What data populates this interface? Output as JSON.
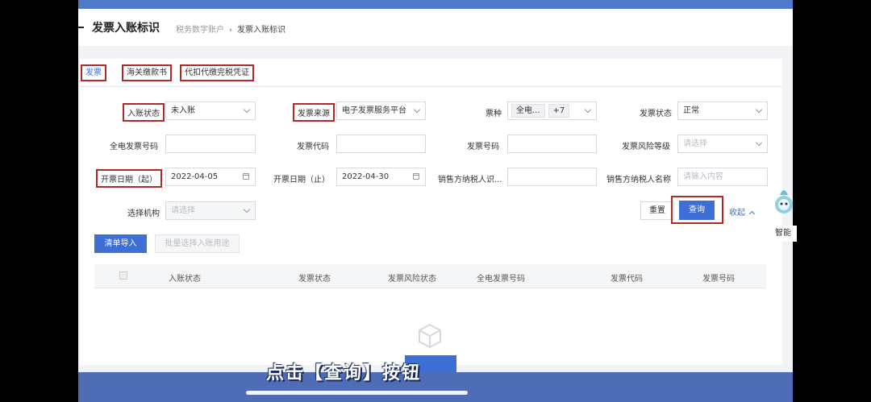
{
  "header": {
    "title": "发票入账标识",
    "breadcrumb": {
      "parent": "税务数字账户",
      "current": "发票入账标识"
    }
  },
  "tabs": [
    {
      "label": "发票"
    },
    {
      "label": "海关缴款书"
    },
    {
      "label": "代扣代缴完税凭证"
    }
  ],
  "filters": {
    "entry_status": {
      "label": "入账状态",
      "value": "未入账"
    },
    "invoice_source": {
      "label": "发票来源",
      "value": "电子发票服务平台"
    },
    "invoice_type": {
      "label": "票种",
      "tag": "全电...",
      "more": "+7"
    },
    "invoice_status": {
      "label": "发票状态",
      "value": "正常"
    },
    "full_e_number": {
      "label": "全电发票号码"
    },
    "invoice_code": {
      "label": "发票代码"
    },
    "invoice_number": {
      "label": "发票号码"
    },
    "risk_level": {
      "label": "发票风险等级",
      "placeholder": "请选择"
    },
    "date_start": {
      "label": "开票日期（起）",
      "value": "2022-04-05"
    },
    "date_end": {
      "label": "开票日期（止）",
      "value": "2022-04-30"
    },
    "seller_tax_id": {
      "label": "销售方纳税人识..."
    },
    "seller_name": {
      "label": "销售方纳税人名称",
      "placeholder": "请输入内容"
    },
    "org": {
      "label": "选择机构",
      "placeholder": "请选择"
    }
  },
  "actions": {
    "reset": "重置",
    "query": "查询",
    "collapse": "收起",
    "import_list": "清单导入",
    "batch_select": "批量选择入账用途"
  },
  "table": {
    "columns": [
      "入账状态",
      "发票状态",
      "发票风险状态",
      "全电发票号码",
      "发票代码",
      "发票号码"
    ]
  },
  "overlay": {
    "subtitle": "点击【查询】按钮",
    "assistant_label": "智能"
  }
}
